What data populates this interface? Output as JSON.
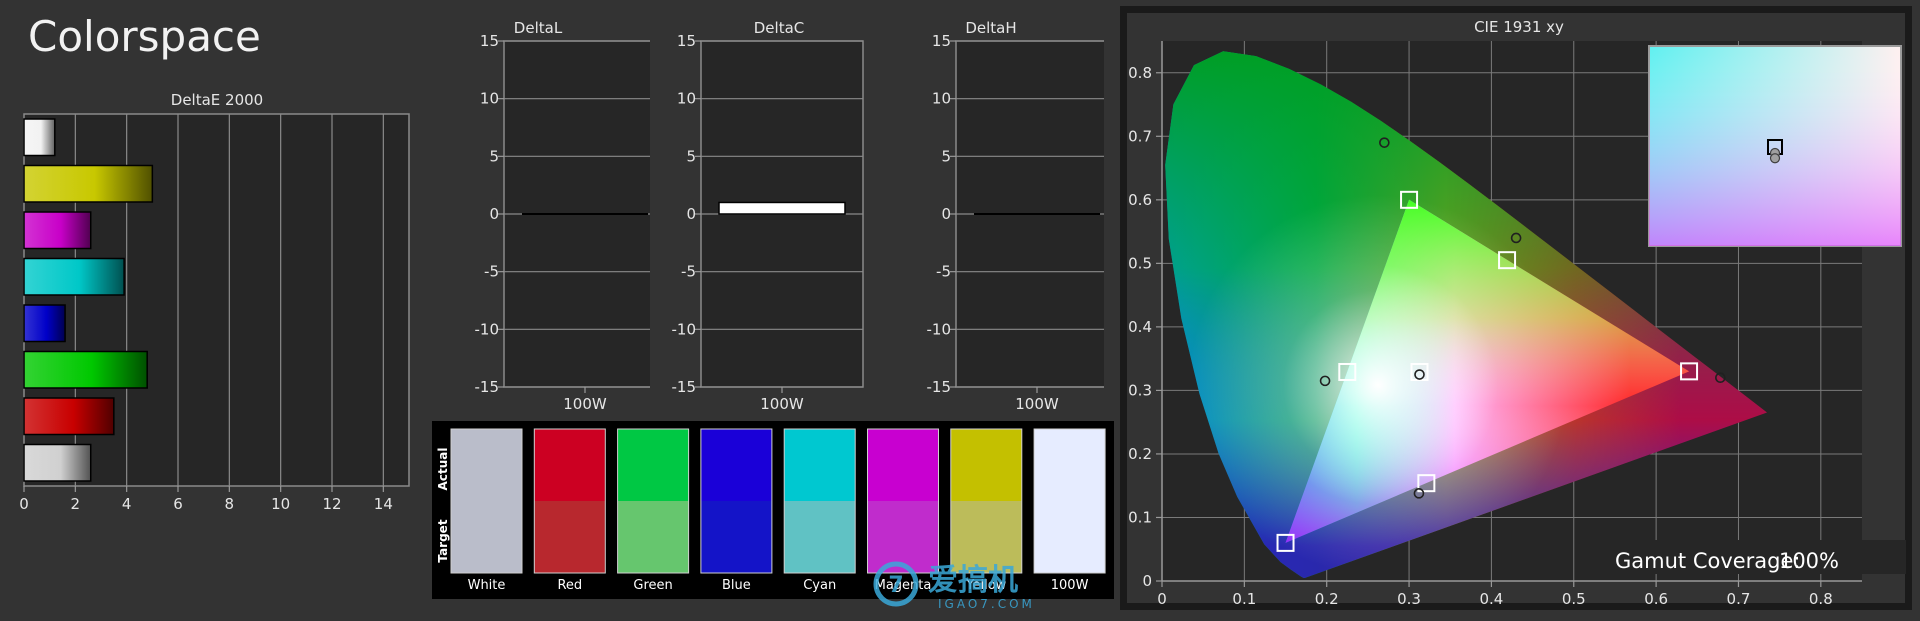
{
  "page": {
    "title": "Colorspace"
  },
  "colors": {
    "background": "#333333",
    "plot_bg": "#262626",
    "grid": "#9a9a9a",
    "text": "#e6e6e6"
  },
  "chart_data": [
    {
      "type": "bar",
      "title": "DeltaE 2000",
      "orientation": "horizontal",
      "categories": [
        "White",
        "Yellow",
        "Magenta",
        "Cyan",
        "Blue",
        "Green",
        "Red",
        "100W"
      ],
      "values": [
        1.2,
        5.0,
        2.6,
        3.9,
        1.6,
        4.8,
        3.5,
        2.6
      ],
      "bar_colors": [
        "#f2f2f2",
        "#c8c800",
        "#c800c8",
        "#00c8c8",
        "#0000c8",
        "#00c800",
        "#c80000",
        "#d0d0d0"
      ],
      "xlim": [
        0,
        15
      ],
      "x_ticks": [
        "0",
        "2",
        "4",
        "6",
        "8",
        "10",
        "12",
        "14"
      ],
      "grid": true
    },
    {
      "type": "bar",
      "title": "DeltaL",
      "categories": [
        "100W"
      ],
      "values": [
        0
      ],
      "ylim": [
        -15,
        15
      ],
      "y_ticks": [
        "15",
        "10",
        "5",
        "0",
        "-5",
        "-10",
        "-15"
      ],
      "grid": true
    },
    {
      "type": "bar",
      "title": "DeltaC",
      "categories": [
        "100W"
      ],
      "values": [
        1.0
      ],
      "ylim": [
        -15,
        15
      ],
      "y_ticks": [
        "15",
        "10",
        "5",
        "0",
        "-5",
        "-10",
        "-15"
      ],
      "grid": true
    },
    {
      "type": "bar",
      "title": "DeltaH",
      "categories": [
        "100W"
      ],
      "values": [
        0
      ],
      "ylim": [
        -15,
        15
      ],
      "y_ticks": [
        "15",
        "10",
        "5",
        "0",
        "-5",
        "-10",
        "-15"
      ],
      "grid": true
    },
    {
      "type": "table",
      "row_labels": [
        "Actual",
        "Target"
      ],
      "columns": [
        "White",
        "Red",
        "Green",
        "Blue",
        "Cyan",
        "Magenta",
        "Yellow",
        "100W"
      ],
      "actual_colors": [
        "#babdca",
        "#cc0022",
        "#00c844",
        "#1a00d8",
        "#00c8d0",
        "#c800d0",
        "#c4c000",
        "#e6ecff"
      ],
      "target_colors": [
        "#babdca",
        "#b8282e",
        "#66c66e",
        "#1414c8",
        "#60c2c4",
        "#c02ccc",
        "#bcbc5a",
        "#e6ecff"
      ]
    },
    {
      "type": "scatter",
      "title": "CIE 1931 xy",
      "xlim": [
        0,
        0.85
      ],
      "ylim": [
        0,
        0.85
      ],
      "x_ticks": [
        "0",
        "0.1",
        "0.2",
        "0.3",
        "0.4",
        "0.5",
        "0.6",
        "0.7",
        "0.8"
      ],
      "y_ticks": [
        "0",
        "0.1",
        "0.2",
        "0.3",
        "0.4",
        "0.5",
        "0.6",
        "0.7",
        "0.8"
      ],
      "grid": true,
      "series": [
        {
          "name": "Target",
          "marker": "square",
          "points": [
            [
              0.64,
              0.33
            ],
            [
              0.3,
              0.6
            ],
            [
              0.15,
              0.06
            ],
            [
              0.225,
              0.329
            ],
            [
              0.321,
              0.154
            ],
            [
              0.419,
              0.505
            ],
            [
              0.3127,
              0.329
            ]
          ]
        },
        {
          "name": "Actual",
          "marker": "circle",
          "points": [
            [
              0.678,
              0.32
            ],
            [
              0.27,
              0.69
            ],
            [
              0.198,
              0.315
            ],
            [
              0.43,
              0.54
            ],
            [
              0.312,
              0.138
            ],
            [
              0.3127,
              0.325
            ]
          ]
        }
      ],
      "inset_points": [
        {
          "marker": "square",
          "x": 0.3127,
          "y": 0.329
        },
        {
          "marker": "circle",
          "x": 0.3127,
          "y": 0.325
        },
        {
          "marker": "circle",
          "x": 0.3127,
          "y": 0.3215
        }
      ],
      "gamut_label": "Gamut Coverage:",
      "gamut_value": "100%"
    }
  ],
  "watermark": {
    "main": "爱搞机",
    "sub": "IGAO7.COM"
  }
}
